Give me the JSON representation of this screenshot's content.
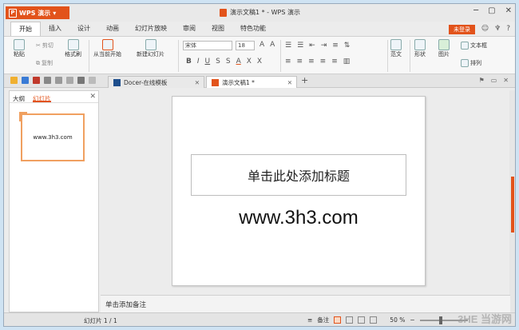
{
  "app": {
    "button_label": "WPS 演示",
    "window_title": "演示文稿1 * - WPS 演示",
    "logo_letter": "P"
  },
  "menu": {
    "tabs": [
      "开始",
      "插入",
      "设计",
      "动画",
      "幻灯片放映",
      "审阅",
      "视图",
      "特色功能"
    ],
    "active": 0,
    "login_label": "未登录"
  },
  "ribbon": {
    "paste": "粘贴",
    "cut": "剪切",
    "copy": "复制",
    "format_painter": "格式刷",
    "from_current": "从当前开始",
    "new_slide": "新建幻灯片",
    "font_name": "宋体",
    "font_size": "18",
    "text_tool": "范文",
    "shape": "形状",
    "picture": "图片",
    "textbox": "文本框",
    "arrange": "排列"
  },
  "doc_tabs": [
    {
      "label": "Docer-在线模板"
    },
    {
      "label": "演示文稿1 *"
    }
  ],
  "left_panel": {
    "tab_outline": "大纲",
    "tab_slides": "幻灯片",
    "thumb_number": "1",
    "thumb_text": "www.3h3.com"
  },
  "slide": {
    "title_placeholder": "单击此处添加标题",
    "content_text": "www.3h3.com"
  },
  "notes": {
    "placeholder": "单击添加备注"
  },
  "status": {
    "page_info": "幻灯片 1 / 1",
    "notes_label": "备注",
    "zoom": "50 %"
  },
  "watermark": "3HE 当游网",
  "colors": {
    "accent": "#e2531b"
  }
}
